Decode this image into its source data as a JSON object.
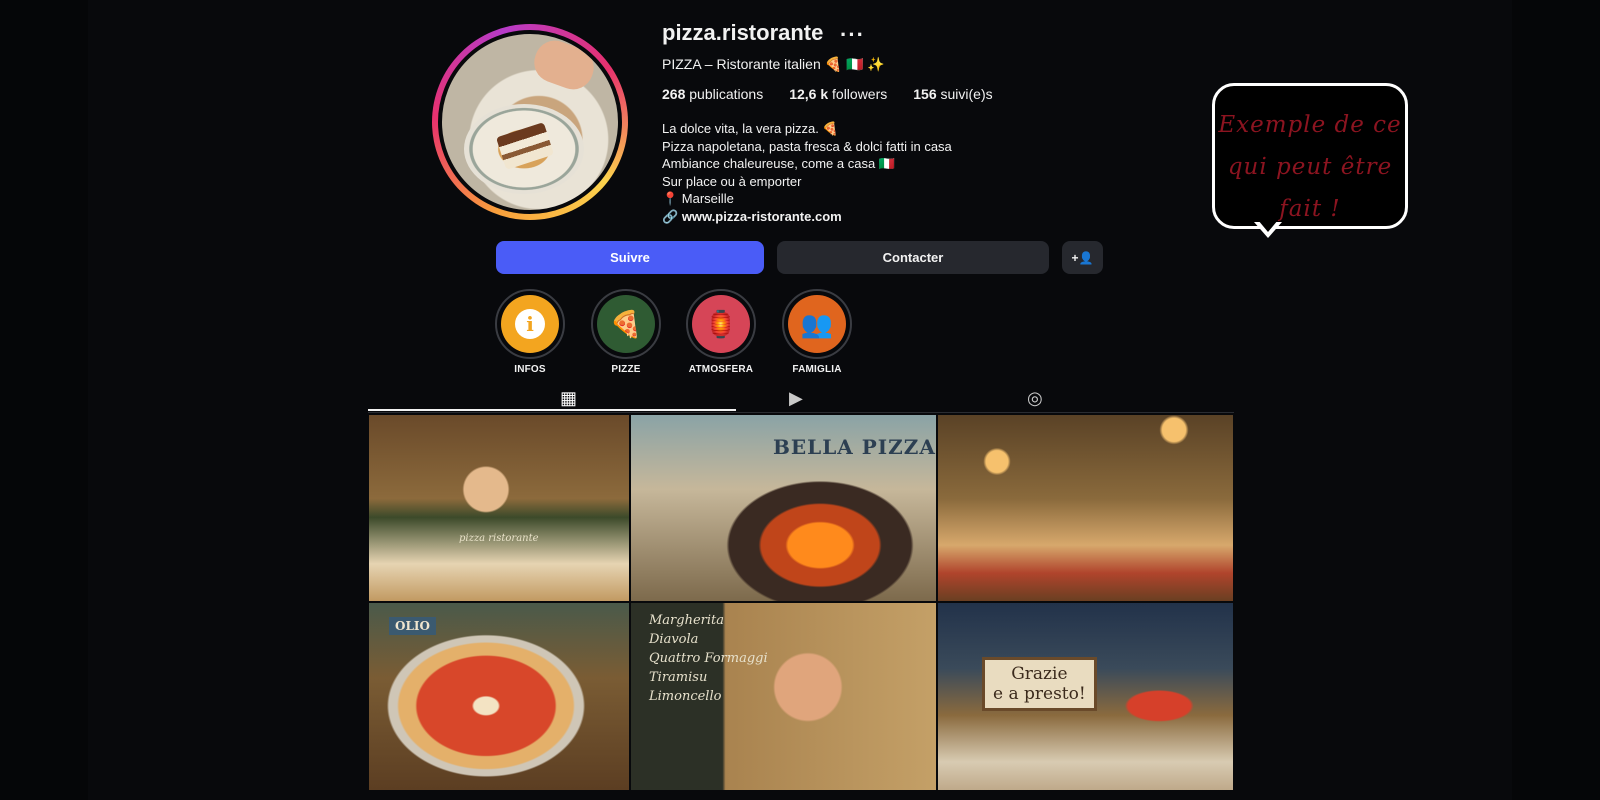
{
  "profile": {
    "username": "pizza.ristorante",
    "more_icon": "more-horizontal-icon",
    "full_name": "PIZZA – Ristorante italien 🍕 🇮🇹 ✨",
    "stats": {
      "posts_count": "268",
      "posts_label": "publications",
      "followers_count": "12,6 k",
      "followers_label": "followers",
      "following_count": "156",
      "following_label": "suivi(e)s"
    },
    "bio": [
      "La dolce vita, la vera pizza. 🍕",
      "Pizza napoletana, pasta fresca & dolci fatti in casa",
      "Ambiance chaleureuse, come a casa 🇮🇹",
      "Sur place ou à emporter",
      "📍 Marseille"
    ],
    "link_icon": "link-icon",
    "website": "www.pizza-ristorante.com"
  },
  "actions": {
    "follow_label": "Suivre",
    "contact_label": "Contacter",
    "add_user_icon": "+👤"
  },
  "highlights": [
    {
      "label": "INFOS",
      "icon": "i",
      "color": "#f3a51f"
    },
    {
      "label": "PIZZE",
      "icon": "🍕",
      "color": "#2f5b33"
    },
    {
      "label": "ATMOSFERA",
      "icon": "🏮",
      "color": "#d64557"
    },
    {
      "label": "FAMIGLIA",
      "icon": "👥",
      "color": "#e0651e"
    }
  ],
  "tabs": [
    {
      "name": "posts",
      "icon": "▦"
    },
    {
      "name": "reels",
      "icon": "▶"
    },
    {
      "name": "tagged",
      "icon": "◎"
    }
  ],
  "posts": [
    {
      "subject": "pizzaiolo stretching dough",
      "caption": "pizza ristorante"
    },
    {
      "subject": "chef at wood-fired oven",
      "caption": "BELLA PIZZA"
    },
    {
      "subject": "friends sharing pizzas",
      "caption": ""
    },
    {
      "subject": "margherita pizza with olive oil",
      "caption": "OLIO"
    },
    {
      "subject": "woman eating spaghetti",
      "caption": "Margherita\nDiavola\nQuattro Formaggi\nTiramisu\nLimoncello"
    },
    {
      "subject": "tiramisu and spritz",
      "caption": "Grazie\ne a presto!"
    }
  ],
  "annotation": {
    "text": "Exemple de ce qui peut être fait !"
  }
}
